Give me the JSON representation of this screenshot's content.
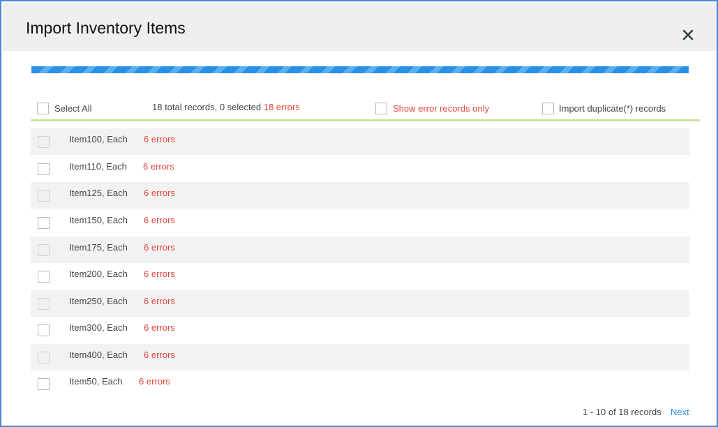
{
  "dialog": {
    "title": "Import Inventory Items",
    "close_icon": "close-icon"
  },
  "progress": {
    "value": 1.0,
    "style": "striped-blue"
  },
  "toolbar": {
    "select_all_label": "Select All",
    "summary_text": "18 total records, 0 selected",
    "summary_errors": "18 errors",
    "show_errors_label": "Show error records only",
    "import_duplicates_label": "Import duplicate(*) records"
  },
  "rows": [
    {
      "name": "Item100, Each",
      "errors": "6 errors"
    },
    {
      "name": "Item110, Each",
      "errors": "6 errors"
    },
    {
      "name": "Item125, Each",
      "errors": "6 errors"
    },
    {
      "name": "Item150, Each",
      "errors": "6 errors"
    },
    {
      "name": "Item175, Each",
      "errors": "6 errors"
    },
    {
      "name": "Item200, Each",
      "errors": "6 errors"
    },
    {
      "name": "Item250, Each",
      "errors": "6 errors"
    },
    {
      "name": "Item300, Each",
      "errors": "6 errors"
    },
    {
      "name": "Item400, Each",
      "errors": "6 errors"
    },
    {
      "name": "Item50, Each",
      "errors": "6 errors"
    }
  ],
  "pager": {
    "range_text": "1 - 10 of 18 records",
    "next_label": "Next"
  },
  "colors": {
    "border": "#4a86d4",
    "header_bg": "#efefef",
    "error": "#e2453c",
    "link": "#2a8fe6",
    "divider": "#c7e3a2"
  }
}
